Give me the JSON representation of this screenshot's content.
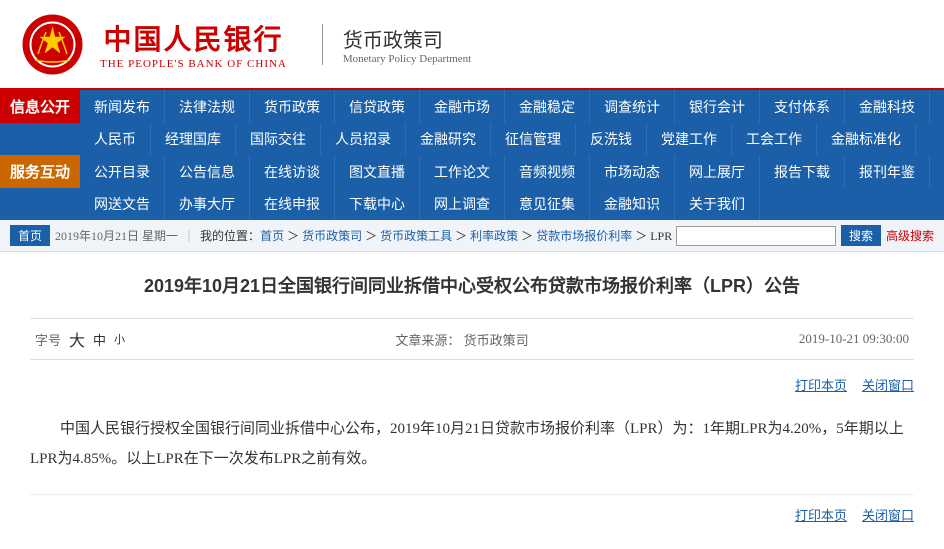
{
  "header": {
    "logo_chinese": "中国人民银行",
    "logo_english": "THE PEOPLE'S BANK OF CHINA",
    "dept_chinese": "货币政策司",
    "dept_english": "Monetary Policy Department"
  },
  "nav": {
    "section1_label": "信息公开",
    "section2_label": "服务互动",
    "row1": [
      "新闻发布",
      "法律法规",
      "货币政策",
      "信贷政策",
      "金融市场",
      "金融稳定",
      "调查统计",
      "银行会计",
      "支付体系",
      "金融科技"
    ],
    "row2": [
      "人民币",
      "经理国库",
      "国际交往",
      "人员招录",
      "金融研究",
      "征信管理",
      "反洗钱",
      "党建工作",
      "工会工作",
      "金融标准化"
    ],
    "row3": [
      "公开目录",
      "公告信息",
      "在线访谈",
      "图文直播",
      "工作论文",
      "音频视频",
      "市场动态",
      "网上展厅",
      "报告下载",
      "报刊年鉴"
    ],
    "row4": [
      "网送文告",
      "办事大厅",
      "在线申报",
      "下载中心",
      "网上调查",
      "意见征集",
      "金融知识",
      "关于我们"
    ]
  },
  "breadcrumb": {
    "home": "首页",
    "date": "2019年10月21日 星期一",
    "path": "我的位置：首页 ＞ 货币政策司 ＞ 货币政策工具 ＞ 利率政策 ＞ 贷款市场报价利率 LPR",
    "search_placeholder": "",
    "search_btn": "搜索",
    "advanced": "高级搜索"
  },
  "article": {
    "title": "2019年10月21日全国银行间同业拆借中心受权公布贷款市场报价利率（LPR）公告",
    "font_label": "字号",
    "font_large": "大",
    "font_medium": "中",
    "font_small": "小",
    "source_label": "文章来源：",
    "source": "货币政策司",
    "date": "2019-10-21 09:30:00",
    "print": "打印本页",
    "close": "关闭窗口",
    "body": "中国人民银行授权全国银行间同业拆借中心公布，2019年10月21日贷款市场报价利率（LPR）为：1年期LPR为4.20%，5年期以上LPR为4.85%。以上LPR在下一次发布LPR之前有效。",
    "print2": "打印本页",
    "close2": "关闭窗口"
  }
}
